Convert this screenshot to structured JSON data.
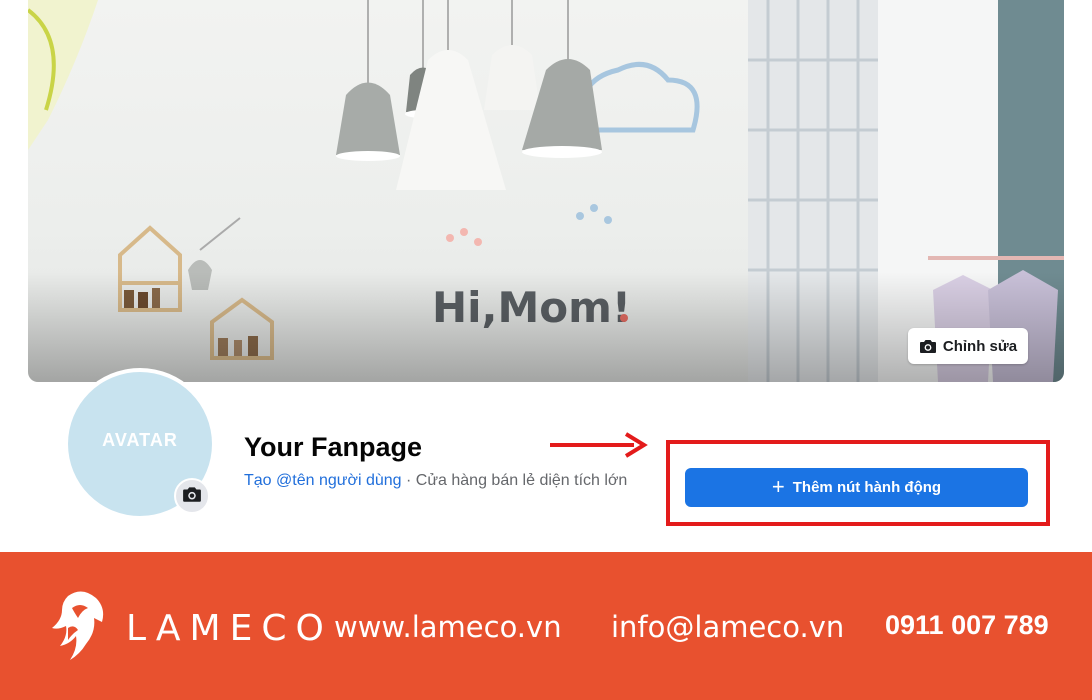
{
  "cover": {
    "wall_text": "Hi, Mom!",
    "edit_button_label": "Chỉnh sửa",
    "edit_icon": "camera-icon"
  },
  "profile": {
    "avatar_placeholder": "AVATAR",
    "avatar_edit_icon": "camera-icon",
    "page_name": "Your Fanpage",
    "username_link": "Tạo @tên người dùng",
    "separator": " · ",
    "category": "Cửa hàng bán lẻ diện tích lớn"
  },
  "action": {
    "button_label": "Thêm nút hành động",
    "button_icon": "plus-icon"
  },
  "annotation": {
    "arrow_color": "#e31b1b",
    "highlight_color": "#e31b1b"
  },
  "footer": {
    "brand": "LAMECO",
    "website": "www.lameco.vn",
    "email": "info@lameco.vn",
    "phone": "0911 007 789",
    "background_color": "#e8512f"
  },
  "colors": {
    "primary_button": "#1b74e4",
    "link": "#216fdb",
    "avatar_bg": "#c8e3ef"
  }
}
